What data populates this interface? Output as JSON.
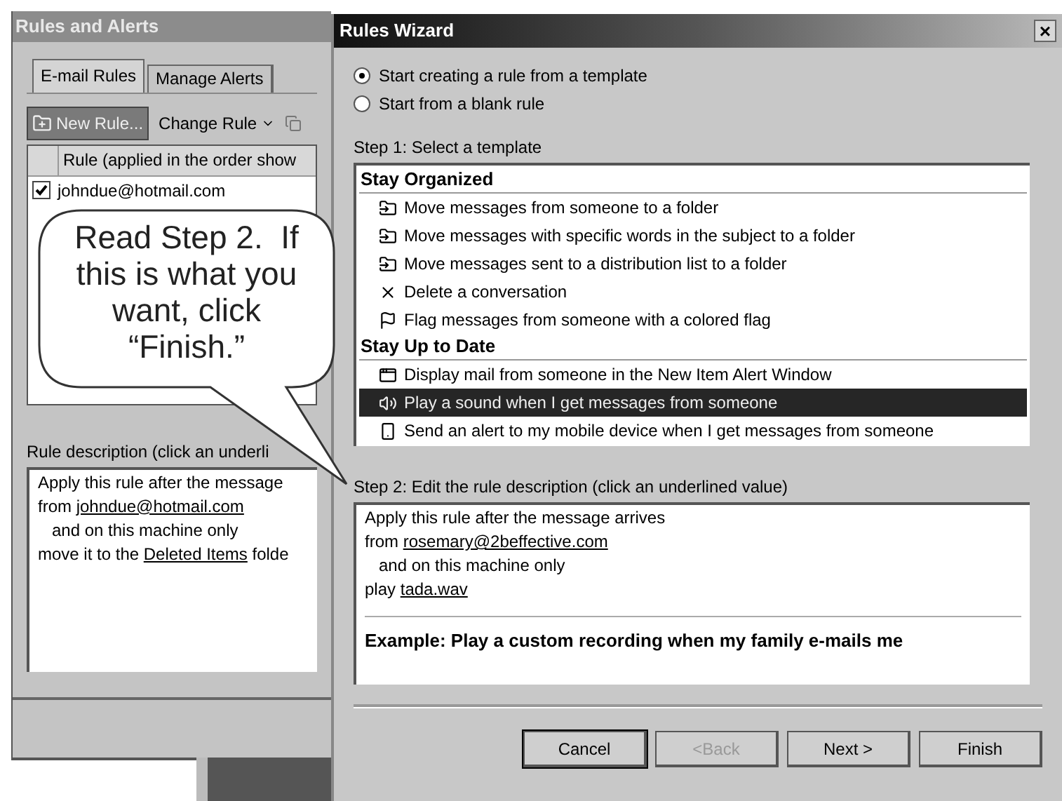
{
  "back_window": {
    "title": "Rules and Alerts",
    "tabs": [
      {
        "label": "E-mail Rules",
        "selected": true
      },
      {
        "label": "Manage Alerts",
        "selected": false
      }
    ],
    "toolbar": [
      {
        "kind": "new",
        "label": "New Rule...",
        "pressed": true
      },
      {
        "kind": "menu",
        "label": "Change Rule",
        "pressed": false
      }
    ],
    "list_header": "Rule (applied in the order show",
    "rules": [
      {
        "label": "johndue@hotmail.com",
        "checked": true
      }
    ],
    "description_label": "Rule description (click an underli",
    "description": [
      {
        "before": "Apply this rule after the message",
        "indent": false
      },
      {
        "before": "from ",
        "link": "johndue@hotmail.com",
        "indent": false
      },
      {
        "before": "and on this machine only",
        "indent": true
      },
      {
        "before": "move it to the ",
        "link": "Deleted Items",
        "after": " folde",
        "indent": false
      }
    ]
  },
  "callout": {
    "text": "Read Step 2.  If this is what you want, click “Finish.”"
  },
  "wizard": {
    "title": "Rules Wizard",
    "close": "×",
    "options": [
      {
        "label": "Start creating a rule from a template",
        "selected": true
      },
      {
        "label": "Start from a blank rule",
        "selected": false
      }
    ],
    "step1": "Step 1: Select a template",
    "groups": [
      {
        "heading": "Stay Organized",
        "items": [
          {
            "kind": "move",
            "label": "Move messages from someone to a folder",
            "selected": false
          },
          {
            "kind": "move",
            "label": "Move messages with specific words in the subject to a folder",
            "selected": false
          },
          {
            "kind": "move",
            "label": "Move messages sent to a distribution list to a folder",
            "selected": false
          },
          {
            "kind": "delete",
            "label": "Delete a conversation",
            "selected": false
          },
          {
            "kind": "flag",
            "label": "Flag messages from someone with a colored flag",
            "selected": false
          }
        ]
      },
      {
        "heading": "Stay Up to Date",
        "items": [
          {
            "kind": "alert",
            "label": "Display mail from someone in the New Item Alert Window",
            "selected": false
          },
          {
            "kind": "sound",
            "label": "Play a sound when I get messages from someone",
            "selected": true
          },
          {
            "kind": "mobile",
            "label": "Send an alert to my mobile device when I get messages from someone",
            "selected": false
          }
        ]
      }
    ],
    "step2": "Step 2: Edit the rule description (click an underlined value)",
    "description": [
      {
        "before": "Apply this rule after the message arrives",
        "indent": false
      },
      {
        "before": "from ",
        "link": "rosemary@2beffective.com",
        "indent": false
      },
      {
        "before": "and on this machine only",
        "indent": true
      },
      {
        "before": "play ",
        "link": "tada.wav",
        "indent": false
      }
    ],
    "example": "Example: Play a custom recording when my family e-mails me",
    "buttons": [
      {
        "label": "Cancel",
        "default": true,
        "disabled": false
      },
      {
        "label": "<Back",
        "default": false,
        "disabled": true
      },
      {
        "label": "Next >",
        "default": false,
        "disabled": false
      },
      {
        "label": "Finish",
        "default": false,
        "disabled": false
      }
    ]
  }
}
